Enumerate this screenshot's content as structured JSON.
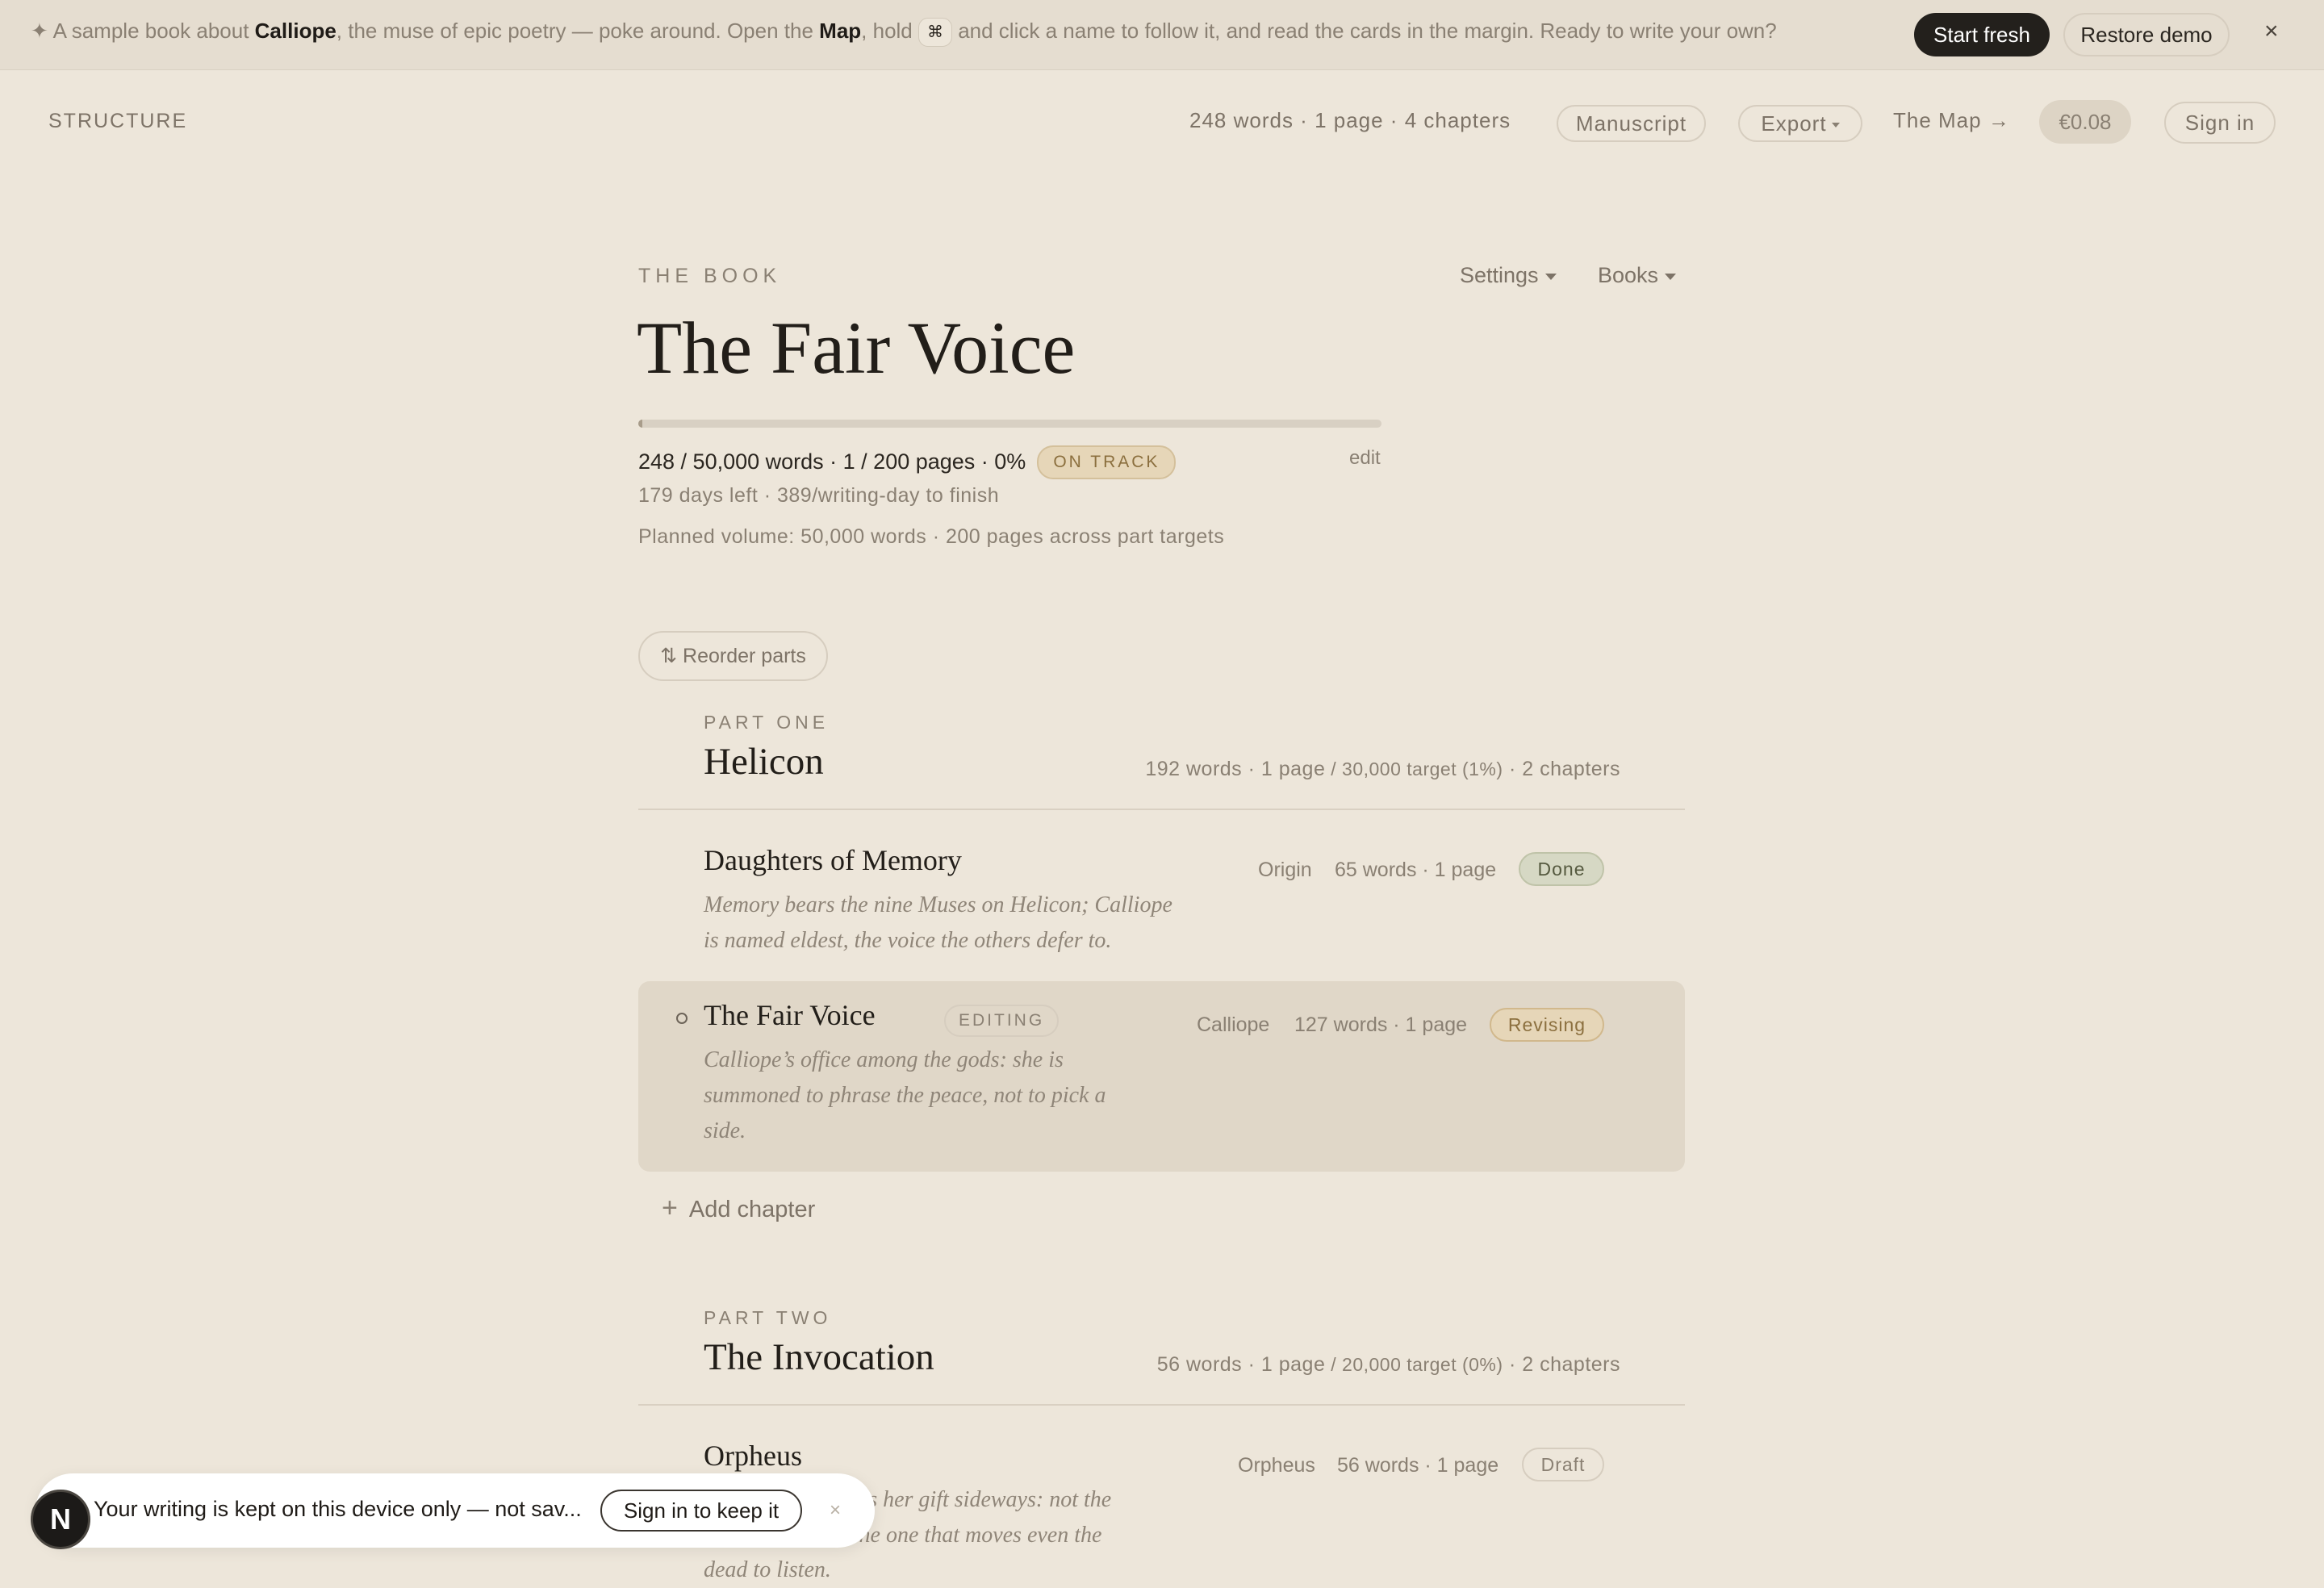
{
  "banner": {
    "star": "✦",
    "t1": "A sample book about ",
    "b1": "Calliope",
    "t2": ", the muse of epic poetry — poke around. Open the ",
    "b2": "Map",
    "t3": ", hold ",
    "kbd": "⌘",
    "t4": " and click a name to follow it, and read the cards in the margin. Ready to write your own?",
    "start_fresh": "Start fresh",
    "restore_demo": "Restore demo",
    "close": "×"
  },
  "topbar": {
    "section": "STRUCTURE",
    "stats": "248 words · 1 page · 4 chapters",
    "manuscript": "Manuscript",
    "export": "Export",
    "map": "The Map →",
    "price": "€0.08",
    "sign_in": "Sign in"
  },
  "book": {
    "eyebrow": "THE BOOK",
    "settings": "Settings",
    "books": "Books",
    "title": "The Fair Voice",
    "progress_fraction": 0.005,
    "stats": "248 / 50,000 words · 1 / 200 pages · 0%",
    "badge": "ON TRACK",
    "edit": "edit",
    "days_left": "179 days left · 389/writing-day to finish",
    "planned": "Planned volume: 50,000 words · 200 pages across part targets"
  },
  "reorder_label": "⇅ Reorder parts",
  "parts": [
    {
      "eyebrow": "PART ONE",
      "title": "Helicon",
      "stats_a": "192 words · 1 page",
      "stats_b": " / 30,000 target (1%)",
      "stats_c": " · 2 chapters",
      "chapters": [
        {
          "title": "Daughters of Memory",
          "desc": "Memory bears the nine Muses on Helicon; Calliope is named eldest, the voice the others defer to.",
          "pov": "Origin",
          "meta": "65 words · 1 page",
          "status": "Done"
        },
        {
          "title": "The Fair Voice",
          "tag": "EDITING",
          "desc": "Calliope’s office among the gods: she is summoned to phrase the peace, not to pick a side.",
          "pov": "Calliope",
          "meta": "127 words · 1 page",
          "status": "Revising"
        }
      ],
      "add_chapter": "Add chapter"
    },
    {
      "eyebrow": "PART TWO",
      "title": "The Invocation",
      "stats_a": "56 words · 1 page",
      "stats_b": " / 20,000 target (0%)",
      "stats_c": " · 2 chapters",
      "chapters": [
        {
          "title": "Orpheus",
          "desc_l1": "ies her gift sideways: not the",
          "desc_l2": ", but the one that moves even the",
          "desc_l3": "dead to listen.",
          "pov": "Orpheus",
          "meta": "56 words · 1 page",
          "status": "Draft"
        }
      ]
    }
  ],
  "toast": {
    "avatar": "N",
    "text": "Your writing is kept on this device only — not sav...",
    "button": "Sign in to keep it",
    "close": "×"
  },
  "colors": {
    "background": "#ede6da",
    "banner": "#e5ddd0",
    "ink": "#221e19",
    "muted": "#8a8073",
    "active_row": "#e0d7c8",
    "done_badge": "#d6d8c4",
    "revising_badge": "#e6d6b8"
  }
}
